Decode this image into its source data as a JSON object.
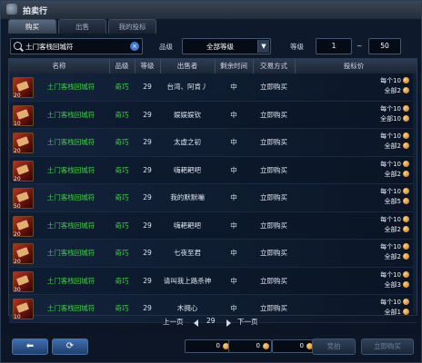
{
  "window": {
    "title": "拍卖行"
  },
  "tabs": [
    {
      "label": "购买",
      "active": true
    },
    {
      "label": "出售",
      "active": false
    },
    {
      "label": "我的投标",
      "active": false
    }
  ],
  "filters": {
    "search_value": "土门客栈回城符",
    "clear_icon": "×",
    "grade_label": "品级",
    "grade_value": "全部等级",
    "level_label": "等级",
    "level_min": "1",
    "level_sep": "~",
    "level_max": "50"
  },
  "table": {
    "headers": [
      "名称",
      "品级",
      "等级",
      "出售者",
      "剩余时间",
      "交易方式",
      "投标价"
    ],
    "rows": [
      {
        "qty": "20",
        "name": "土门客栈回城符",
        "grade": "奇巧",
        "level": "29",
        "seller": "台湾、阿肯丿",
        "time": "中",
        "mode": "立即购买",
        "price_each": "每个10",
        "price_total": "全部2"
      },
      {
        "qty": "10",
        "name": "土门客栈回城符",
        "grade": "奇巧",
        "level": "29",
        "seller": "娱娱娱钦",
        "time": "中",
        "mode": "立即购买",
        "price_each": "每个10",
        "price_total": "全部10"
      },
      {
        "qty": "20",
        "name": "土门客栈回城符",
        "grade": "奇巧",
        "level": "29",
        "seller": "太虚之初",
        "time": "中",
        "mode": "立即购买",
        "price_each": "每个10",
        "price_total": "全部2"
      },
      {
        "qty": "20",
        "name": "土门客栈回城符",
        "grade": "奇巧",
        "level": "29",
        "seller": "嗨耙耙吧",
        "time": "中",
        "mode": "立即购买",
        "price_each": "每个10",
        "price_total": "全部2"
      },
      {
        "qty": "50",
        "name": "土门客栈回城符",
        "grade": "奇巧",
        "level": "29",
        "seller": "我的默默嘣",
        "time": "中",
        "mode": "立即购买",
        "price_each": "每个10",
        "price_total": "全部5"
      },
      {
        "qty": "20",
        "name": "土门客栈回城符",
        "grade": "奇巧",
        "level": "29",
        "seller": "嗨耙耙吧",
        "time": "中",
        "mode": "立即购买",
        "price_each": "每个10",
        "price_total": "全部2"
      },
      {
        "qty": "20",
        "name": "土门客栈回城符",
        "grade": "奇巧",
        "level": "29",
        "seller": "七夜至君",
        "time": "中",
        "mode": "立即购买",
        "price_each": "每个10",
        "price_total": "全部2"
      },
      {
        "qty": "30",
        "name": "土门客栈回城符",
        "grade": "奇巧",
        "level": "29",
        "seller": "请叫我上路杀神",
        "time": "中",
        "mode": "立即购买",
        "price_each": "每个10",
        "price_total": "全部3"
      },
      {
        "qty": "10",
        "name": "土门客栈回城符",
        "grade": "奇巧",
        "level": "29",
        "seller": "木拥心",
        "time": "中",
        "mode": "立即购买",
        "price_each": "每个10",
        "price_total": "全部1"
      }
    ]
  },
  "pager": {
    "prev_label": "上一页",
    "page": "29",
    "next_label": "下一页"
  },
  "footer": {
    "back_icon": "back-arrow-icon",
    "refresh_icon": "refresh-icon",
    "coin_1": "0",
    "coin_2": "0",
    "coin_3": "0",
    "bid_label": "竞拍",
    "buy_label": "立即购买"
  },
  "colors": {
    "green_text": "#38d248",
    "accent_blue": "#3f6fb0",
    "coin_gold": "#ffb84a"
  }
}
